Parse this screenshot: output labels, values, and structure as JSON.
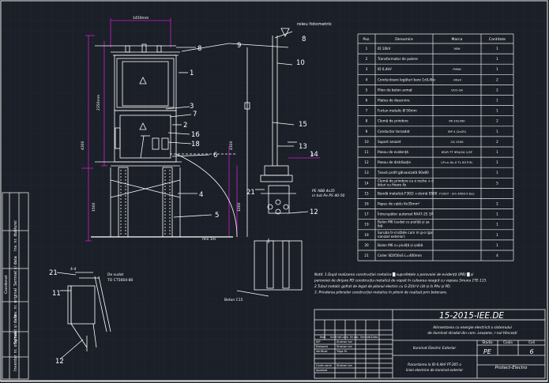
{
  "colors": {
    "background": "#1b1f27",
    "grid": "#262c36",
    "line": "#ffffff",
    "magenta": "#d01cd0",
    "frame": "#e8e8e8"
  },
  "drawing": {
    "header_label": "releu fotometric",
    "dim_top": "1450mm",
    "dim_left_total": "4300",
    "dim_left_upper": "2350mm",
    "dim_left_lower": "1500",
    "dim_right_height": "4300",
    "dim_right_low": "1000",
    "dim_right_small": "4",
    "dim_bottom": "min 1m",
    "beton_label": "Beton C15",
    "pe_cable_label": "PE ABB 4x35 in tub Pe PS 40-50",
    "tc_label": "De sudat\nTO CT5664-80",
    "section_ref": "4-4",
    "callouts_left": [
      "8",
      "1",
      "3",
      "7",
      "2",
      "16",
      "18",
      "6",
      "4",
      "5",
      "9",
      "8",
      "10",
      "15",
      "13",
      "11",
      "12",
      "14",
      "21",
      "11",
      "12",
      "21"
    ],
    "right_label_2": "2"
  },
  "table": {
    "headers": [
      "Poz.",
      "Denumire",
      "Marca",
      "Cantitate"
    ],
    "rows": [
      [
        "1",
        "ID 10kV",
        "VBH",
        "1"
      ],
      [
        "2",
        "Transformator de putere",
        "",
        "1"
      ],
      [
        "3",
        "ID 0,4kV",
        "PVBH",
        "1"
      ],
      [
        "4",
        "Conductoare legături bare 1x0,4kv",
        "-40x4",
        "2"
      ],
      [
        "5",
        "Pilon de beton armat",
        "VCO-2A",
        "2"
      ],
      [
        "6",
        "Platou de deservire",
        "",
        "1"
      ],
      [
        "7",
        "Furtun metalic Ø 50mm",
        "",
        "1"
      ],
      [
        "8",
        "Clemă de prindere",
        "PA 25x300",
        "2"
      ],
      [
        "9",
        "Conductor torsadat",
        "SIP 4 (2x25)",
        "1"
      ],
      [
        "10",
        "Suport anozet",
        "CA 1500",
        "2"
      ],
      [
        "11",
        "Panou de evidență",
        "IEUR TT 9R4/2A 1/2F",
        "1"
      ],
      [
        "12",
        "Panou de distribuție",
        "LP=n 0n-0 TL 83 P.3L",
        "1"
      ],
      [
        "13",
        "Țeavă profil gălvanizată 60x80",
        "",
        "1"
      ],
      [
        "14",
        "Clemă de prindere cu o reche + dibluri cu fixare 4z",
        "",
        "5"
      ],
      [
        "15",
        "Bandă metalică F30/2 +clemă 0500",
        "F1007 - 2m 4500-5 bec",
        ""
      ],
      [
        "16",
        "Papuc de cablu 6x35mm²",
        "",
        "2"
      ],
      [
        "17",
        "Întrerupător automat RA47-25 1P",
        "",
        "1"
      ],
      [
        "19",
        "Bulon M6 (sudat cu piuliță și șaibă",
        "",
        "1"
      ],
      [
        "19",
        "Șuruba tr-crutăde cum m g-o (galvanizat exterior)",
        "",
        "1"
      ],
      [
        "20",
        "Bulon M6 cu piuliță și șaibă",
        "",
        "1"
      ],
      [
        "21",
        "Colier SDX50xS L=400mm",
        "",
        "4"
      ]
    ]
  },
  "notes": [
    "Notă: 1.După realizarea construcției metalice █ suprafețele a perovoiei de evidență (IPB) █ și",
    "perovoiei de dirijare PD construcția metalică de vopsit în culoarea neagră cu vopsea 3muna 1TE-115.",
    "2.Tubul metalic gofrat de legat de pilonul electric cu G-ZUU-V cât și în PAv și PD.",
    "3. Prinderea pilonelor construcției metalice în pilonii de realizat prin betonare."
  ],
  "title_block": {
    "code": "15-2015-IEE.DE",
    "description": "Alimentarea cu energie electrică a sistemului de iluminat stradal din com. Leușene, r-nul Hîncești",
    "sheet_title": "Iluminat Electric Exterior",
    "drawing_title": "Racordarea la ID-0,4kV PT-205 a liniei electrice de iluminat exterior",
    "company": "Protect-Electro",
    "col_headers": [
      "Nod",
      "Schimb",
      "Coala",
      "Nr.doc",
      "Semnăt.",
      "Data"
    ],
    "roles": [
      "ISP",
      "Elaborat",
      "Verificat",
      "",
      "",
      "Contr.norm",
      "Aprobat"
    ],
    "names": [
      "Stratan Ion",
      "Stratan Ion",
      "Triga M.",
      "",
      "",
      "Stratan Ion",
      ""
    ],
    "stage_label": "Stadia",
    "sheet_label": "Coala",
    "sheets_label": "Coli",
    "stage": "PE",
    "sheets": "6"
  },
  "left_strip": [
    "Inventar nr. original",
    "Semnat și data",
    "Inv. nr. original",
    "Semnat și data",
    "Inv. nr. dublurei"
  ],
  "left_strip_label": "Coordonat"
}
